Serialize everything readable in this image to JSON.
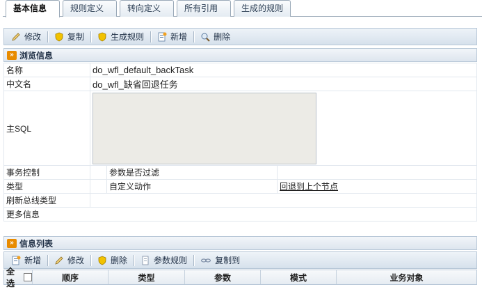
{
  "tabs": [
    "基本信息",
    "规则定义",
    "转向定义",
    "所有引用",
    "生成的规则"
  ],
  "toolbar1": {
    "edit": "修改",
    "copy": "复制",
    "generate": "生成规则",
    "add": "新增",
    "delete": "删除"
  },
  "browse": {
    "title": "浏览信息",
    "name_label": "名称",
    "name_value": "do_wfl_default_backTask",
    "cn_label": "中文名",
    "cn_value": "do_wfl_缺省回退任务",
    "sql_label": "主SQL",
    "tx_label": "事务控制",
    "param_filter_label": "参数是否过滤",
    "type_label": "类型",
    "type_value": "自定义动作",
    "type_link": "回退到上个节点",
    "bus_label": "刷新总线类型",
    "more_label": "更多信息"
  },
  "list": {
    "title": "信息列表",
    "toolbar": {
      "add": "新增",
      "edit": "修改",
      "delete": "删除",
      "param_rule": "参数规则",
      "copy_to": "复制到"
    },
    "columns": [
      "全选",
      "顺序",
      "类型",
      "参数",
      "模式",
      "业务对象"
    ]
  },
  "colors": {
    "accent_orange": "#e88b00",
    "toolbar_bg": "#dce6f0",
    "border": "#b7c7d7"
  }
}
